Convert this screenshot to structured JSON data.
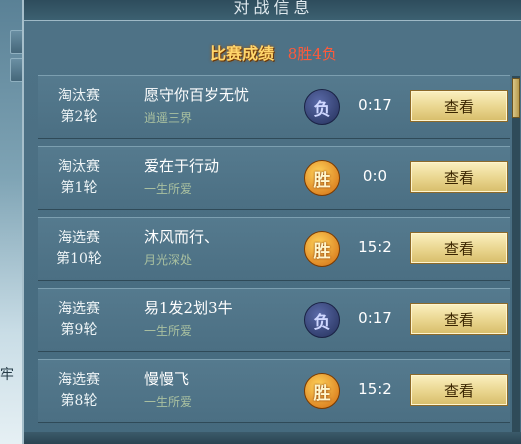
{
  "window": {
    "title": "对战信息"
  },
  "side": {
    "char": "牢"
  },
  "summary": {
    "label": "比赛成绩",
    "value": "8胜4负"
  },
  "colors": {
    "win": "#e08a1a",
    "lose": "#34427a",
    "accent": "#ffd66b",
    "record": "#ff5a3a"
  },
  "rows": [
    {
      "stage": "淘汰赛",
      "round": "第2轮",
      "name": "愿守你百岁无忧",
      "sub": "逍遥三界",
      "result": "负",
      "result_icon": "lose-badge-icon",
      "score": "0:17",
      "button": "查看"
    },
    {
      "stage": "淘汰赛",
      "round": "第1轮",
      "name": "爱在于行动",
      "sub": "一生所爱",
      "result": "胜",
      "result_icon": "win-badge-icon",
      "score": "0:0",
      "button": "查看"
    },
    {
      "stage": "海选赛",
      "round": "第10轮",
      "name": "沐风而行、",
      "sub": "月光深处",
      "result": "胜",
      "result_icon": "win-badge-icon",
      "score": "15:2",
      "button": "查看"
    },
    {
      "stage": "海选赛",
      "round": "第9轮",
      "name": "易1发2划3牛",
      "sub": "一生所爱",
      "result": "负",
      "result_icon": "lose-badge-icon",
      "score": "0:17",
      "button": "查看"
    },
    {
      "stage": "海选赛",
      "round": "第8轮",
      "name": "慢慢飞",
      "sub": "一生所爱",
      "result": "胜",
      "result_icon": "win-badge-icon",
      "score": "15:2",
      "button": "查看"
    }
  ]
}
